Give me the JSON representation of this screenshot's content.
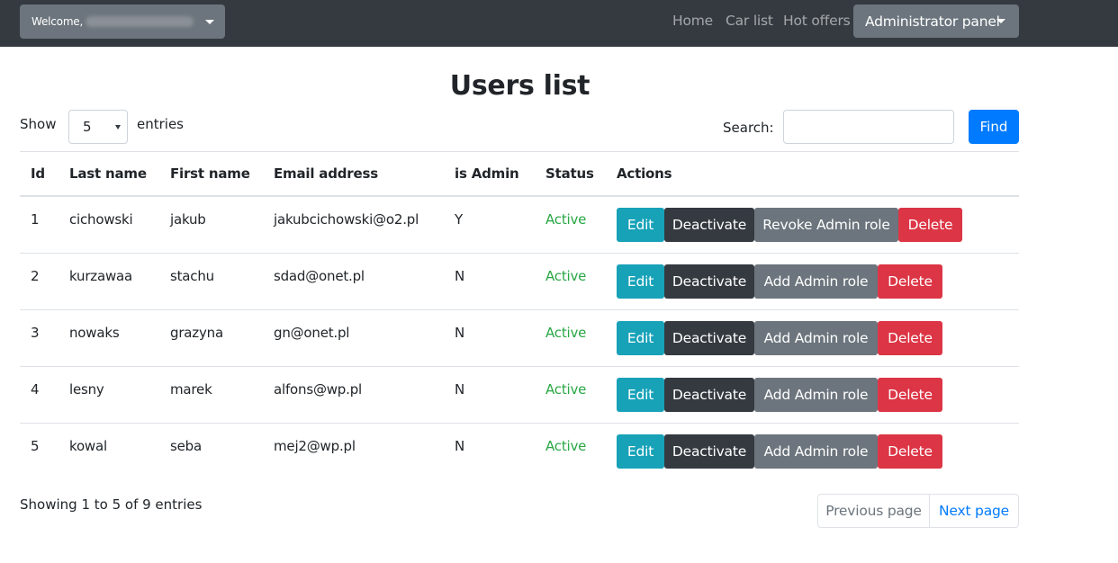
{
  "navbar": {
    "welcome_label": "Welcome,",
    "links": [
      "Home",
      "Car list",
      "Hot offers"
    ],
    "admin_label": "Administrator panel"
  },
  "page": {
    "title": "Users list",
    "show_label": "Show",
    "entries_value": "5",
    "entries_label": "entries",
    "search_label": "Search:",
    "search_value": "",
    "find_label": "Find"
  },
  "table": {
    "headers": [
      "Id",
      "Last name",
      "First name",
      "Email address",
      "is Admin",
      "Status",
      "Actions"
    ],
    "rows": [
      {
        "id": "1",
        "last": "cichowski",
        "first": "jakub",
        "email": "jakubcichowski@o2.pl",
        "admin": "Y",
        "status": "Active",
        "edit": "Edit",
        "deactivate": "Deactivate",
        "role": "Revoke Admin role",
        "delete": "Delete"
      },
      {
        "id": "2",
        "last": "kurzawaa",
        "first": "stachu",
        "email": "sdad@onet.pl",
        "admin": "N",
        "status": "Active",
        "edit": "Edit",
        "deactivate": "Deactivate",
        "role": "Add Admin role",
        "delete": "Delete"
      },
      {
        "id": "3",
        "last": "nowaks",
        "first": "grazyna",
        "email": "gn@onet.pl",
        "admin": "N",
        "status": "Active",
        "edit": "Edit",
        "deactivate": "Deactivate",
        "role": "Add Admin role",
        "delete": "Delete"
      },
      {
        "id": "4",
        "last": "lesny",
        "first": "marek",
        "email": "alfons@wp.pl",
        "admin": "N",
        "status": "Active",
        "edit": "Edit",
        "deactivate": "Deactivate",
        "role": "Add Admin role",
        "delete": "Delete"
      },
      {
        "id": "5",
        "last": "kowal",
        "first": "seba",
        "email": "mej2@wp.pl",
        "admin": "N",
        "status": "Active",
        "edit": "Edit",
        "deactivate": "Deactivate",
        "role": "Add Admin role",
        "delete": "Delete"
      }
    ]
  },
  "footer": {
    "info": "Showing 1 to 5 of 9 entries",
    "prev_label": "Previous page",
    "next_label": "Next page"
  },
  "colors": {
    "navbar": "#343a40",
    "primary": "#007bff",
    "info": "#17a2b8",
    "dark": "#343a40",
    "secondary": "#6c757d",
    "danger": "#dc3545",
    "success": "#28a745"
  }
}
